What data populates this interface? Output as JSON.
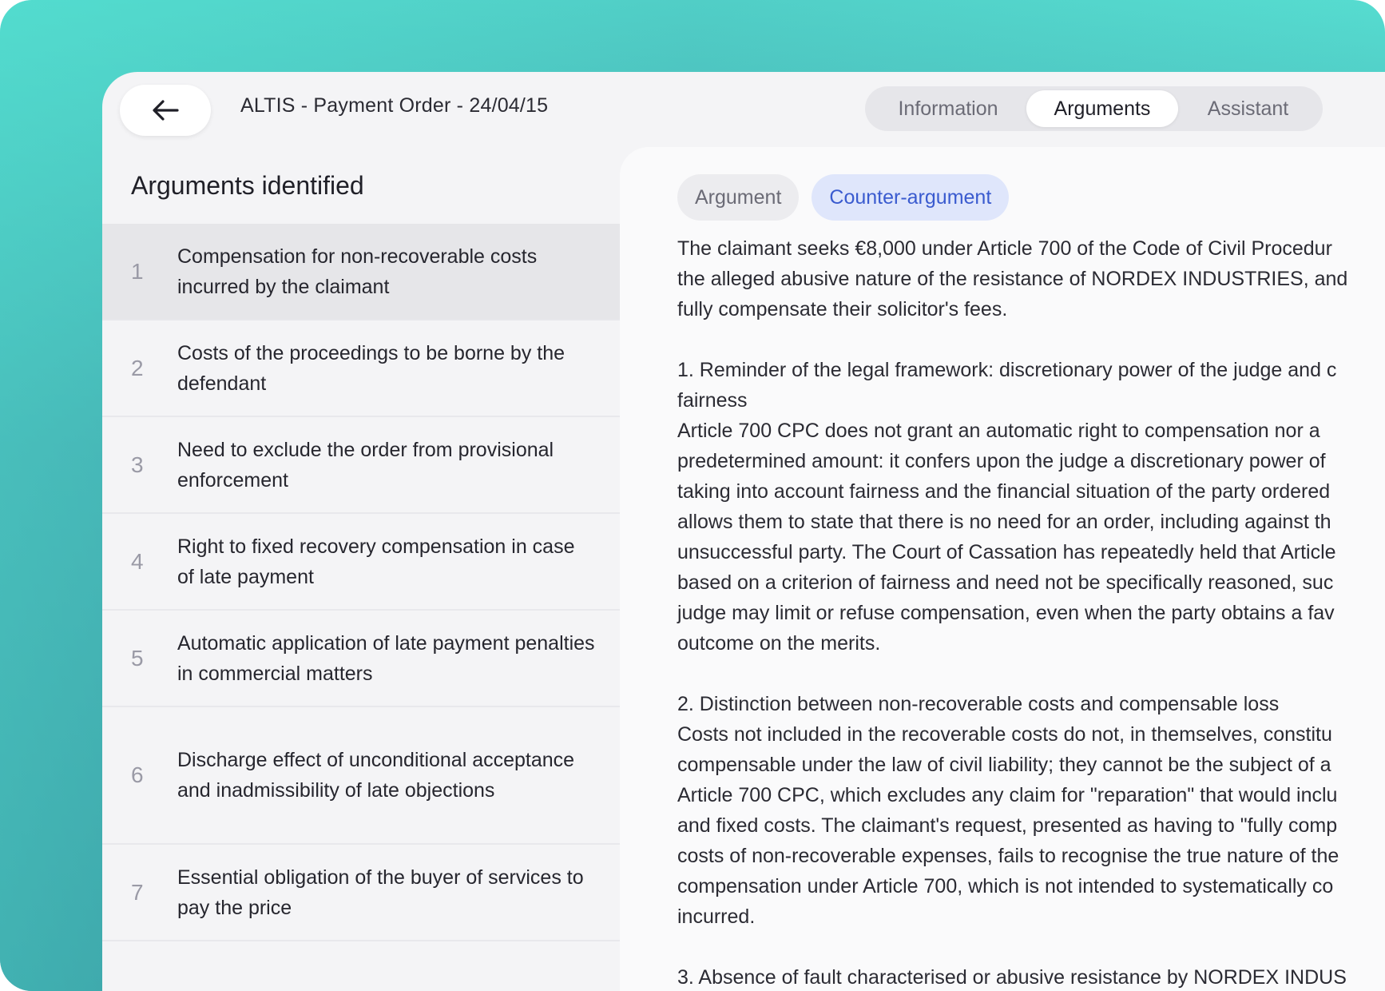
{
  "header": {
    "title": "ALTIS - Payment Order - 24/04/15",
    "tabs": [
      {
        "label": "Information",
        "active": false
      },
      {
        "label": "Arguments",
        "active": true
      },
      {
        "label": "Assistant",
        "active": false
      }
    ]
  },
  "sidebar": {
    "title": "Arguments identified",
    "items": [
      {
        "number": "1",
        "label": "Compensation for non-recoverable costs incurred by the claimant",
        "selected": true
      },
      {
        "number": "2",
        "label": "Costs of the proceedings to be borne by the defendant"
      },
      {
        "number": "3",
        "label": "Need to exclude the order from provisional enforcement"
      },
      {
        "number": "4",
        "label": "Right to fixed recovery compensation in case of late payment"
      },
      {
        "number": "5",
        "label": "Automatic application of late payment penalties in commercial matters"
      },
      {
        "number": "6",
        "label": "Discharge effect of unconditional acceptance and inadmissibility of late objections"
      },
      {
        "number": "7",
        "label": "Essential obligation of the buyer of services to pay the price"
      }
    ]
  },
  "detail": {
    "toggle": {
      "argument_label": "Argument",
      "counter_label": "Counter-argument",
      "active": "Counter-argument"
    },
    "paragraphs": [
      [
        "The claimant seeks €8,000 under Article 700 of the Code of Civil Procedur",
        "the alleged abusive nature of the resistance of NORDEX INDUSTRIES, and",
        "fully compensate their solicitor's fees."
      ],
      [
        "1. Reminder of the legal framework: discretionary power of the judge and c",
        "fairness",
        "Article 700 CPC does not grant an automatic right to compensation nor a",
        "predetermined amount: it confers upon the judge a discretionary power of",
        "taking into account fairness and the financial situation of the party ordered",
        "allows them to state that there is no need for an order, including against th",
        "unsuccessful party. The Court of Cassation has repeatedly held that Article",
        "based on a criterion of fairness and need not be specifically reasoned, suc",
        "judge may limit or refuse compensation, even when the party obtains a fav",
        "outcome on the merits."
      ],
      [
        "2. Distinction between non-recoverable costs and compensable loss",
        "Costs not included in the recoverable costs do not, in themselves, constitu",
        "compensable under the law of civil liability; they cannot be the subject of a",
        "Article 700 CPC, which excludes any claim for \"reparation\" that would inclu",
        "and fixed costs. The claimant's request, presented as having to \"fully comp",
        "costs of non-recoverable expenses, fails to recognise the true nature of the",
        "compensation under Article 700, which is not intended to systematically co",
        "incurred."
      ],
      [
        "3. Absence of fault characterised or abusive resistance by NORDEX INDUS"
      ]
    ]
  },
  "icons": {
    "back": "arrow-left-icon"
  },
  "colors": {
    "accent_blue": "#3a5bcf",
    "accent_blue_bg": "#dfe6fb",
    "teal_bg": "#4fc9c4"
  }
}
